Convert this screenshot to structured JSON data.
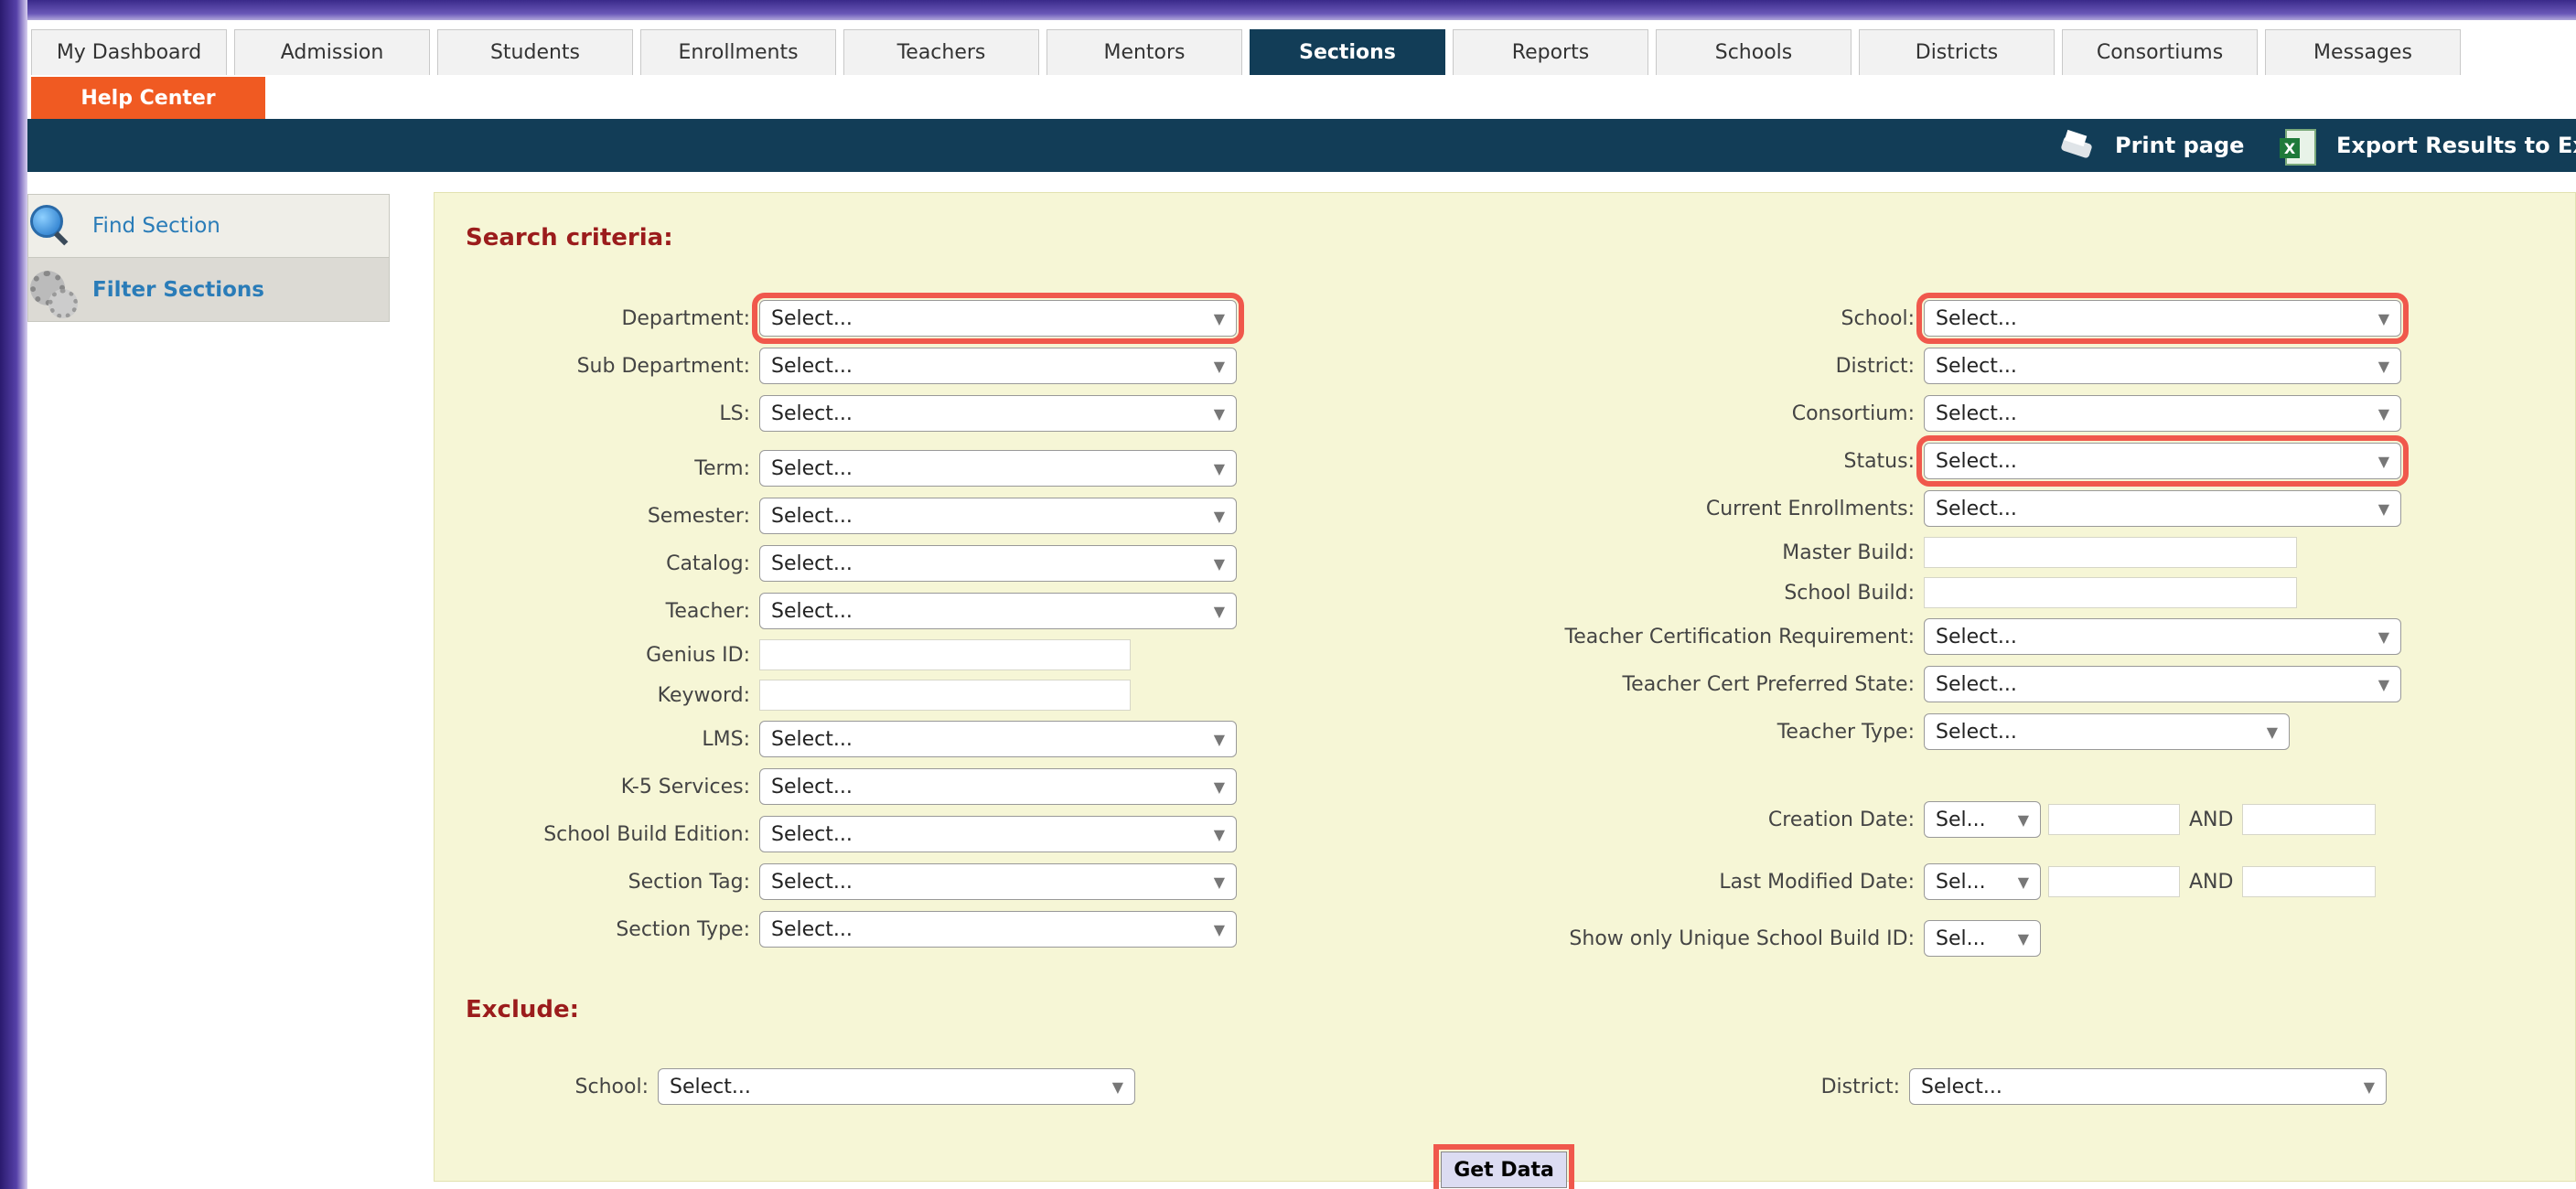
{
  "tabs": [
    {
      "label": "My Dashboard"
    },
    {
      "label": "Admission"
    },
    {
      "label": "Students"
    },
    {
      "label": "Enrollments"
    },
    {
      "label": "Teachers"
    },
    {
      "label": "Mentors"
    },
    {
      "label": "Sections",
      "active": true
    },
    {
      "label": "Reports"
    },
    {
      "label": "Schools"
    },
    {
      "label": "Districts"
    },
    {
      "label": "Consortiums"
    },
    {
      "label": "Messages"
    }
  ],
  "help_center": "Help Center",
  "header_bar": {
    "print": "Print page",
    "export": "Export Results to Exc"
  },
  "sidebar": {
    "items": [
      {
        "label": "Find Section",
        "icon": "magnifier-icon"
      },
      {
        "label": "Filter Sections",
        "icon": "gears-icon"
      }
    ]
  },
  "search": {
    "title": "Search criteria:",
    "left": [
      {
        "label": "Department:",
        "value": "Select..."
      },
      {
        "label": "Sub Department:",
        "value": "Select..."
      },
      {
        "label": "LS:",
        "value": "Select..."
      },
      {
        "label": "Term:",
        "value": "Select..."
      },
      {
        "label": "Semester:",
        "value": "Select..."
      },
      {
        "label": "Catalog:",
        "value": "Select..."
      },
      {
        "label": "Teacher:",
        "value": "Select..."
      },
      {
        "label": "Genius ID:",
        "value": ""
      },
      {
        "label": "Keyword:",
        "value": ""
      },
      {
        "label": "LMS:",
        "value": "Select..."
      },
      {
        "label": "K-5 Services:",
        "value": "Select..."
      },
      {
        "label": "School Build Edition:",
        "value": "Select..."
      },
      {
        "label": "Section Tag:",
        "value": "Select..."
      },
      {
        "label": "Section Type:",
        "value": "Select..."
      }
    ],
    "right": [
      {
        "label": "School:",
        "value": "Select..."
      },
      {
        "label": "District:",
        "value": "Select..."
      },
      {
        "label": "Consortium:",
        "value": "Select..."
      },
      {
        "label": "Status:",
        "value": "Select..."
      },
      {
        "label": "Current Enrollments:",
        "value": "Select..."
      },
      {
        "label": "Master Build:",
        "value": ""
      },
      {
        "label": "School Build:",
        "value": ""
      },
      {
        "label": "Teacher Certification Requirement:",
        "value": "Select..."
      },
      {
        "label": "Teacher Cert Preferred State:",
        "value": "Select..."
      },
      {
        "label": "Teacher Type:",
        "value": "Select..."
      },
      {
        "label": "Creation Date:",
        "value": "Sel..."
      },
      {
        "label": "Last Modified Date:",
        "value": "Sel..."
      },
      {
        "label": "Show only Unique School Build ID:",
        "value": "Sel..."
      }
    ],
    "and_label": "AND"
  },
  "exclude": {
    "title": "Exclude:",
    "school_label": "School:",
    "school_value": "Select...",
    "district_label": "District:",
    "district_value": "Select..."
  },
  "get_data": "Get Data",
  "colors": {
    "nav": "#123d57",
    "help": "#f05a22",
    "panel": "#f6f6d6",
    "title": "#9b1c1c",
    "highlight": "#f0584c"
  }
}
